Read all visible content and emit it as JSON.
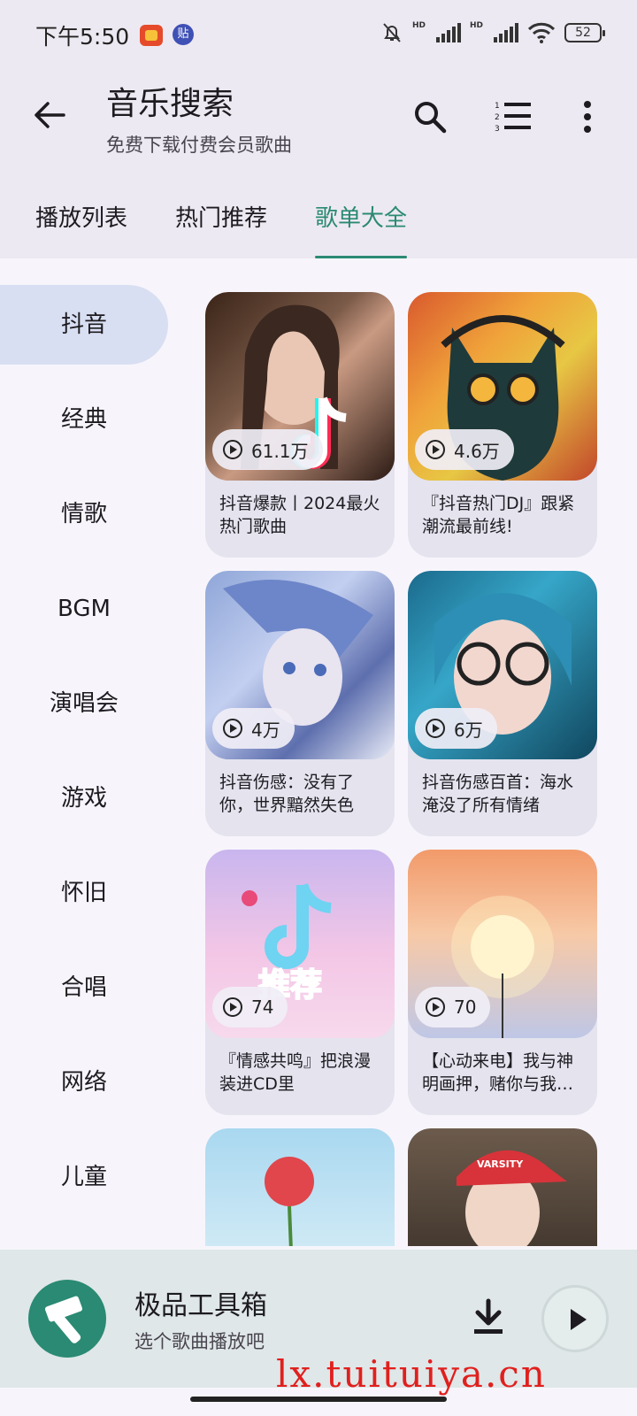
{
  "status_bar": {
    "time": "下午5:50",
    "badge2": "贴",
    "battery": "52",
    "hd": "HD"
  },
  "header": {
    "title": "音乐搜索",
    "subtitle": "免费下载付费会员歌曲"
  },
  "tabs": [
    {
      "label": "播放列表"
    },
    {
      "label": "热门推荐"
    },
    {
      "label": "歌单大全",
      "active": true
    }
  ],
  "categories": [
    "抖音",
    "经典",
    "情歌",
    "BGM",
    "演唱会",
    "游戏",
    "怀旧",
    "合唱",
    "网络",
    "儿童"
  ],
  "playlists": [
    {
      "plays": "61.1万",
      "title": "抖音爆款丨2024最火热门歌曲"
    },
    {
      "plays": "4.6万",
      "title": "『抖音热门DJ』跟紧潮流最前线!"
    },
    {
      "plays": "4万",
      "title": "抖音伤感：没有了你，世界黯然失色"
    },
    {
      "plays": "6万",
      "title": "抖音伤感百首：海水淹没了所有情绪"
    },
    {
      "plays": "74",
      "title": "『情感共鸣』把浪漫装进CD里"
    },
    {
      "plays": "70",
      "title": "【心动来电】我与神明画押，赌你与我…"
    }
  ],
  "cover_text": {
    "tuijian": "推荐",
    "varsity": "VARSITY"
  },
  "player": {
    "title": "极品工具箱",
    "subtitle": "选个歌曲播放吧"
  },
  "watermark": "lx.tuituiya.cn",
  "colors": {
    "accent": "#2a8a73",
    "category_active_bg": "#d9dff2",
    "player_bg": "#dfe7e8"
  }
}
